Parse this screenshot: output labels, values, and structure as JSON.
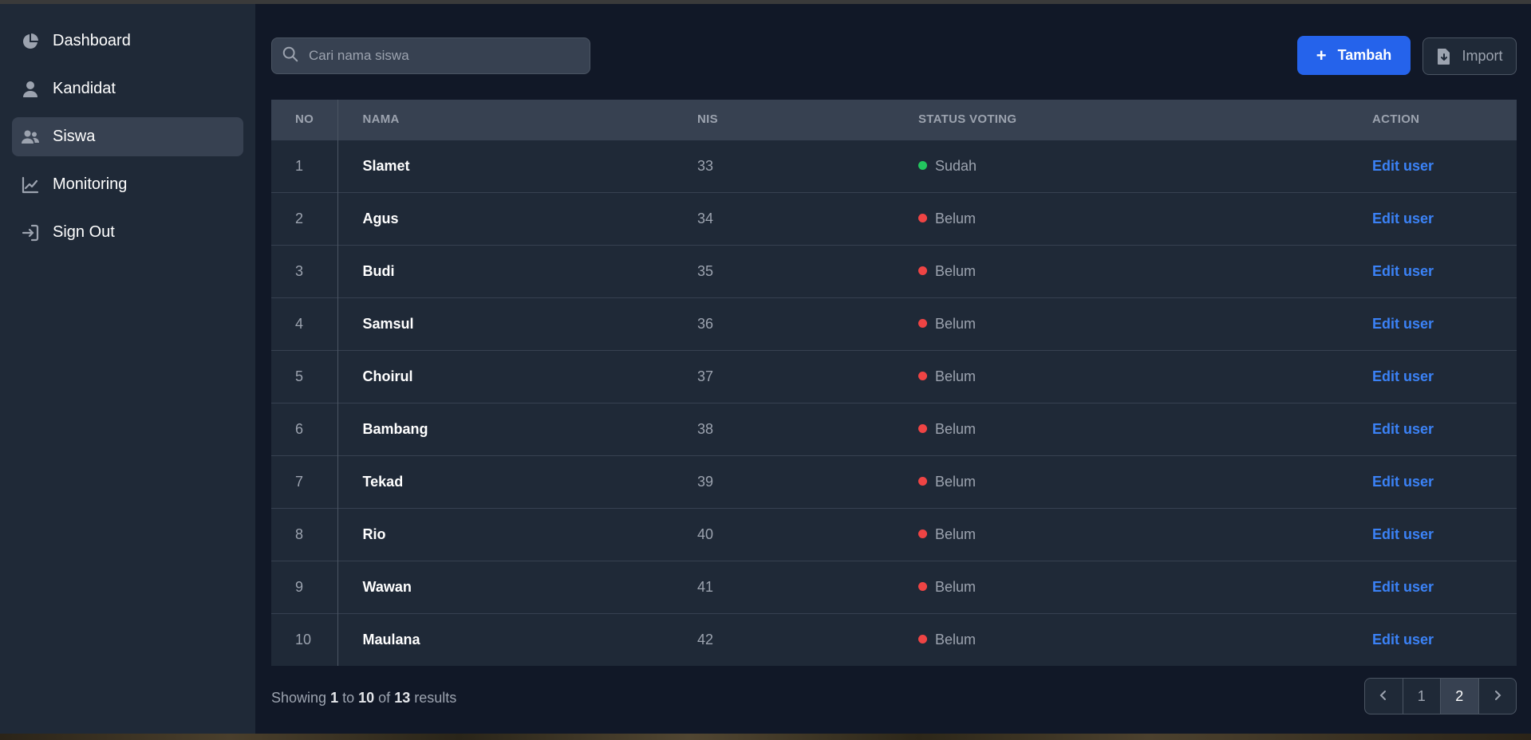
{
  "sidebar": {
    "items": [
      {
        "label": "Dashboard",
        "icon": "chart-pie-icon"
      },
      {
        "label": "Kandidat",
        "icon": "user-icon"
      },
      {
        "label": "Siswa",
        "icon": "users-icon",
        "active": true
      },
      {
        "label": "Monitoring",
        "icon": "chart-line-icon"
      },
      {
        "label": "Sign Out",
        "icon": "sign-out-icon"
      }
    ]
  },
  "search": {
    "placeholder": "Cari nama siswa"
  },
  "toolbar": {
    "add_label": "Tambah",
    "import_label": "Import"
  },
  "table": {
    "headers": {
      "no": "NO",
      "nama": "NAMA",
      "nis": "NIS",
      "status": "STATUS VOTING",
      "action": "ACTION"
    },
    "rows": [
      {
        "no": "1",
        "nama": "Slamet",
        "nis": "33",
        "status": "Sudah",
        "action": "Edit user"
      },
      {
        "no": "2",
        "nama": "Agus",
        "nis": "34",
        "status": "Belum",
        "action": "Edit user"
      },
      {
        "no": "3",
        "nama": "Budi",
        "nis": "35",
        "status": "Belum",
        "action": "Edit user"
      },
      {
        "no": "4",
        "nama": "Samsul",
        "nis": "36",
        "status": "Belum",
        "action": "Edit user"
      },
      {
        "no": "5",
        "nama": "Choirul",
        "nis": "37",
        "status": "Belum",
        "action": "Edit user"
      },
      {
        "no": "6",
        "nama": "Bambang",
        "nis": "38",
        "status": "Belum",
        "action": "Edit user"
      },
      {
        "no": "7",
        "nama": "Tekad",
        "nis": "39",
        "status": "Belum",
        "action": "Edit user"
      },
      {
        "no": "8",
        "nama": "Rio",
        "nis": "40",
        "status": "Belum",
        "action": "Edit user"
      },
      {
        "no": "9",
        "nama": "Wawan",
        "nis": "41",
        "status": "Belum",
        "action": "Edit user"
      },
      {
        "no": "10",
        "nama": "Maulana",
        "nis": "42",
        "status": "Belum",
        "action": "Edit user"
      }
    ]
  },
  "footer": {
    "showing": "Showing",
    "from": "1",
    "to_word": "to",
    "to": "10",
    "of_word": "of",
    "total": "13",
    "results": "results"
  },
  "pagination": {
    "pages": [
      "1",
      "2"
    ],
    "current": "2"
  },
  "colors": {
    "accent": "#2563eb",
    "link": "#3b82f6",
    "status_sudah": "#22c55e",
    "status_belum": "#ef4444",
    "sidebar_bg": "#1f2937",
    "main_bg": "#111827"
  }
}
